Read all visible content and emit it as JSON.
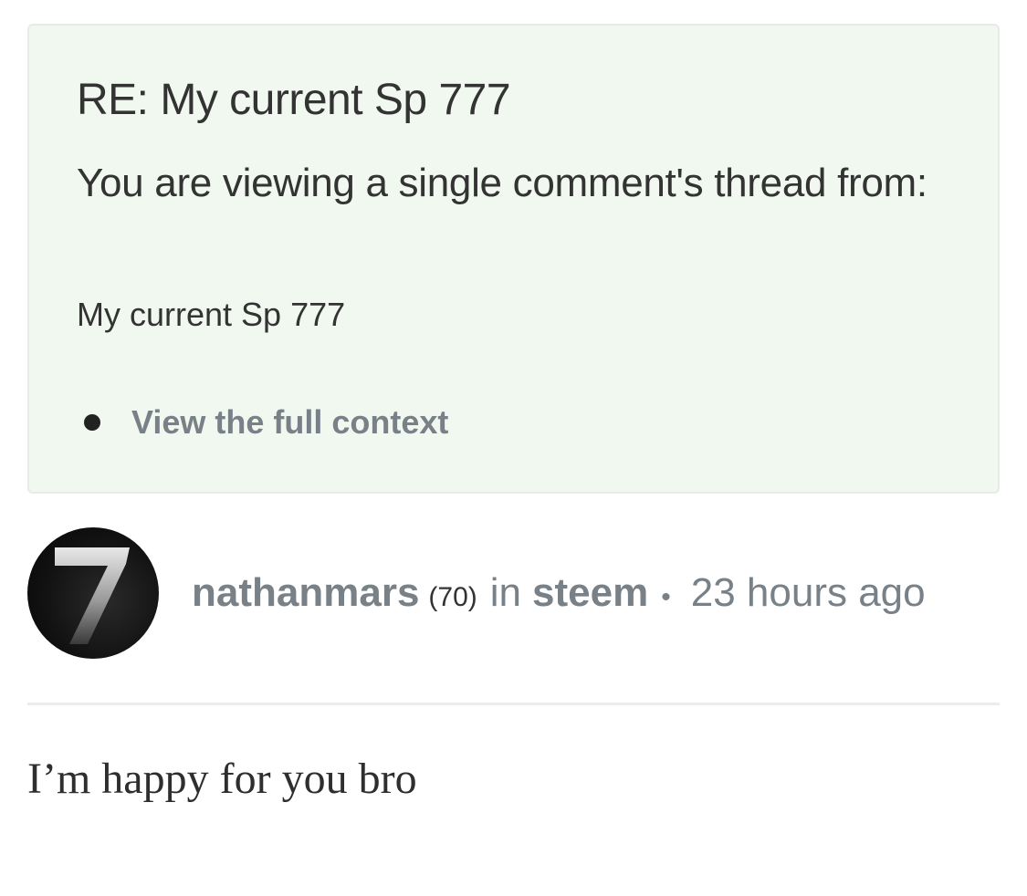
{
  "context": {
    "title": "RE: My current Sp 777",
    "description": "You are viewing a single comment's thread from:",
    "parent_post_title": "My current Sp 777",
    "links": [
      {
        "label": "View the full context"
      }
    ]
  },
  "comment": {
    "author": "nathanmars",
    "reputation": "(70)",
    "in_label": "in",
    "community": "steem",
    "separator": "•",
    "timestamp": "23 hours ago",
    "avatar_icon": "seven-logo-icon",
    "body": "I’m happy for you bro"
  },
  "colors": {
    "context_bg": "#f0f8ef",
    "meta_text": "#788187",
    "body_text": "#333333"
  }
}
